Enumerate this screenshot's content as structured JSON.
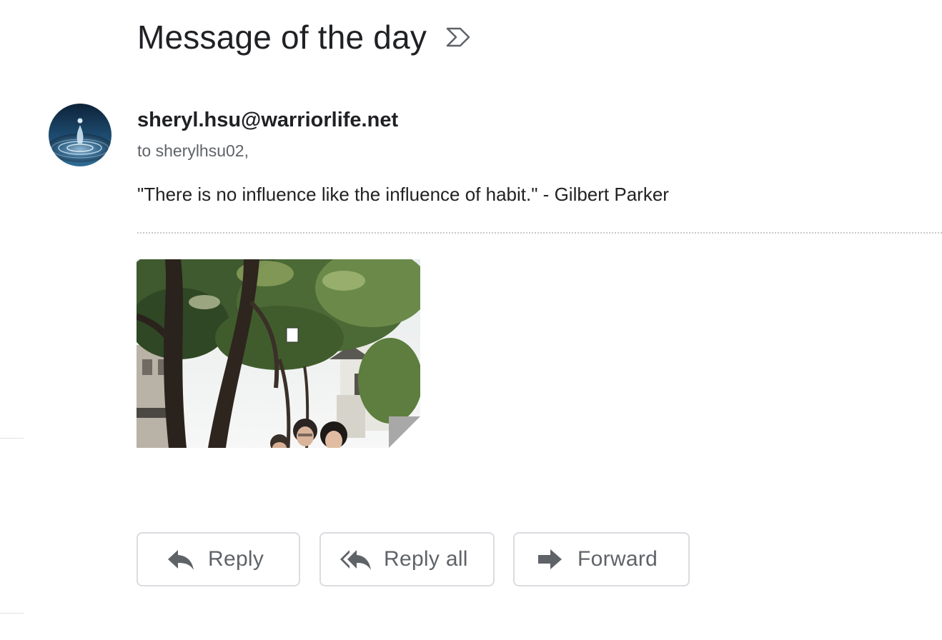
{
  "email": {
    "subject": "Message of the day",
    "sender": "sheryl.hsu@warriorlife.net",
    "recipient": "to sherylhsu02,",
    "body": "\"There is no influence like the influence of habit.\" - Gilbert Parker",
    "attachment_icon": "photo-thumbnail",
    "label_icon": "label-outline-icon",
    "avatar_icon": "water-drop-avatar"
  },
  "actions": {
    "reply_label": "Reply",
    "reply_all_label": "Reply all",
    "forward_label": "Forward"
  },
  "colors": {
    "text_primary": "#202124",
    "text_secondary": "#5f6368",
    "button_border": "#dadce0",
    "icon_gray": "#5f6368"
  }
}
